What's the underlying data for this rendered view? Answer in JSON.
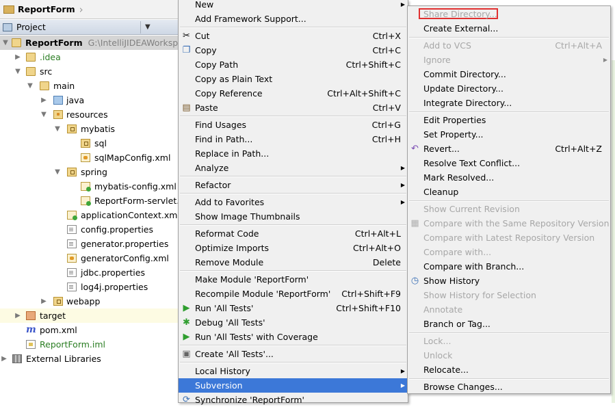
{
  "breadcrumb": {
    "project": "ReportForm"
  },
  "project_header": {
    "label": "Project"
  },
  "tree": [
    {
      "label": "ReportForm",
      "path": "G:\\IntelliJIDEAWorkspace",
      "icon": "folder-icon",
      "expanded": true
    },
    {
      "label": ".idea",
      "icon": "folder-icon",
      "expanded": false
    },
    {
      "label": "src",
      "icon": "folder-icon",
      "expanded": true
    },
    {
      "label": "main",
      "icon": "folder-icon",
      "expanded": true
    },
    {
      "label": "java",
      "icon": "source-folder-icon",
      "expanded": false
    },
    {
      "label": "resources",
      "icon": "resources-folder-icon",
      "expanded": true
    },
    {
      "label": "mybatis",
      "icon": "package-icon",
      "expanded": true
    },
    {
      "label": "sql",
      "icon": "package-icon"
    },
    {
      "label": "sqlMapConfig.xml",
      "icon": "xml-file-icon"
    },
    {
      "label": "spring",
      "icon": "package-icon",
      "expanded": true
    },
    {
      "label": "mybatis-config.xml",
      "icon": "spring-xml-icon"
    },
    {
      "label": "ReportForm-servlet.xml",
      "icon": "spring-xml-icon"
    },
    {
      "label": "applicationContext.xml",
      "icon": "spring-xml-icon"
    },
    {
      "label": "config.properties",
      "icon": "properties-file-icon"
    },
    {
      "label": "generator.properties",
      "icon": "properties-file-icon"
    },
    {
      "label": "generatorConfig.xml",
      "icon": "xml-file-icon"
    },
    {
      "label": "jdbc.properties",
      "icon": "properties-file-icon"
    },
    {
      "label": "log4j.properties",
      "icon": "properties-file-icon"
    },
    {
      "label": "webapp",
      "icon": "package-icon",
      "expanded": false
    },
    {
      "label": "target",
      "icon": "excluded-folder-icon",
      "expanded": false
    },
    {
      "label": "pom.xml",
      "icon": "maven-icon"
    },
    {
      "label": "ReportForm.iml",
      "icon": "iml-file-icon"
    },
    {
      "label": "External Libraries",
      "icon": "libraries-icon",
      "expanded": false
    }
  ],
  "context_menu": {
    "items": [
      {
        "label": "New",
        "submenu": true
      },
      {
        "label": "Add Framework Support..."
      },
      {
        "label": "Cut",
        "shortcut": "Ctrl+X",
        "icon": "scissors-icon"
      },
      {
        "label": "Copy",
        "shortcut": "Ctrl+C",
        "icon": "copy-icon"
      },
      {
        "label": "Copy Path",
        "shortcut": "Ctrl+Shift+C"
      },
      {
        "label": "Copy as Plain Text"
      },
      {
        "label": "Copy Reference",
        "shortcut": "Ctrl+Alt+Shift+C"
      },
      {
        "label": "Paste",
        "shortcut": "Ctrl+V",
        "icon": "paste-icon"
      },
      {
        "label": "Find Usages",
        "shortcut": "Ctrl+G"
      },
      {
        "label": "Find in Path...",
        "shortcut": "Ctrl+H"
      },
      {
        "label": "Replace in Path..."
      },
      {
        "label": "Analyze",
        "submenu": true
      },
      {
        "label": "Refactor",
        "submenu": true
      },
      {
        "label": "Add to Favorites",
        "submenu": true
      },
      {
        "label": "Show Image Thumbnails"
      },
      {
        "label": "Reformat Code",
        "shortcut": "Ctrl+Alt+L"
      },
      {
        "label": "Optimize Imports",
        "shortcut": "Ctrl+Alt+O"
      },
      {
        "label": "Remove Module",
        "shortcut": "Delete"
      },
      {
        "label": "Make Module 'ReportForm'"
      },
      {
        "label": "Recompile Module 'ReportForm'",
        "shortcut": "Ctrl+Shift+F9"
      },
      {
        "label": "Run 'All Tests'",
        "shortcut": "Ctrl+Shift+F10",
        "icon": "run-icon"
      },
      {
        "label": "Debug 'All Tests'",
        "icon": "debug-icon"
      },
      {
        "label": "Run 'All Tests' with Coverage",
        "icon": "coverage-icon"
      },
      {
        "label": "Create 'All Tests'...",
        "icon": "create-test-icon"
      },
      {
        "label": "Local History",
        "submenu": true
      },
      {
        "label": "Subversion",
        "submenu": true,
        "active": true
      },
      {
        "label": "Synchronize 'ReportForm'",
        "icon": "sync-icon"
      }
    ]
  },
  "subversion_menu": {
    "items": [
      {
        "label": "Share Directory...",
        "disabled": true,
        "highlighted_box": true
      },
      {
        "label": "Create External..."
      },
      {
        "label": "Add to VCS",
        "shortcut": "Ctrl+Alt+A",
        "disabled": true
      },
      {
        "label": "Ignore",
        "disabled": true,
        "submenu": true
      },
      {
        "label": "Commit Directory..."
      },
      {
        "label": "Update Directory..."
      },
      {
        "label": "Integrate Directory..."
      },
      {
        "label": "Edit Properties"
      },
      {
        "label": "Set Property..."
      },
      {
        "label": "Revert...",
        "shortcut": "Ctrl+Alt+Z",
        "icon": "revert-icon"
      },
      {
        "label": "Resolve Text Conflict..."
      },
      {
        "label": "Mark Resolved..."
      },
      {
        "label": "Cleanup"
      },
      {
        "label": "Show Current Revision",
        "disabled": true
      },
      {
        "label": "Compare with the Same Repository Version",
        "disabled": true,
        "icon": "compare-icon"
      },
      {
        "label": "Compare with Latest Repository Version",
        "disabled": true
      },
      {
        "label": "Compare with...",
        "disabled": true
      },
      {
        "label": "Compare with Branch..."
      },
      {
        "label": "Show History",
        "icon": "history-icon"
      },
      {
        "label": "Show History for Selection",
        "disabled": true
      },
      {
        "label": "Annotate",
        "disabled": true
      },
      {
        "label": "Branch or Tag..."
      },
      {
        "label": "Lock...",
        "disabled": true
      },
      {
        "label": "Unlock",
        "disabled": true
      },
      {
        "label": "Relocate..."
      },
      {
        "label": "Browse Changes..."
      }
    ]
  },
  "colors": {
    "menu_highlight": "#3c78d8",
    "annotation_box": "#e03030",
    "disabled_text": "#a7a7a7",
    "vcs_green_text": "#2a7d22"
  }
}
